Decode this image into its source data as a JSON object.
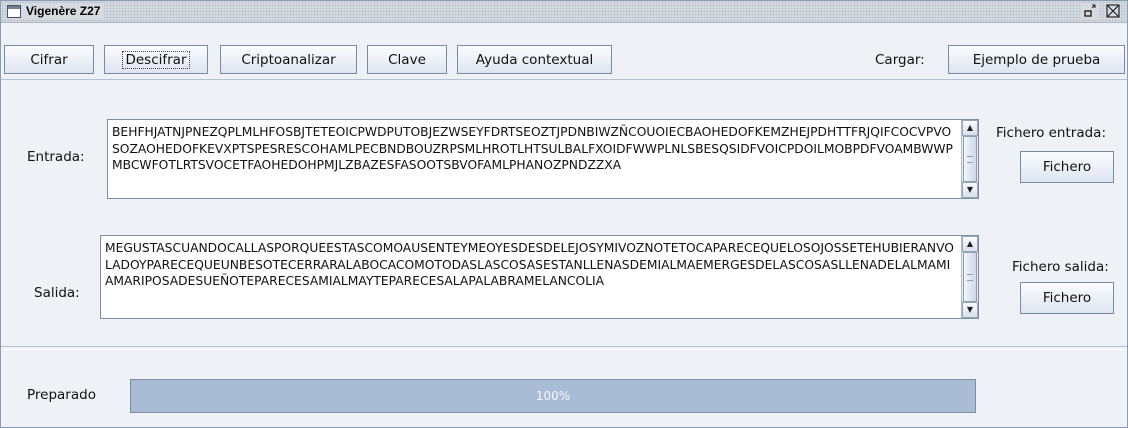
{
  "window": {
    "title": "Vigenère Z27",
    "restore_icon": "restore-icon",
    "close_icon": "close-icon"
  },
  "toolbar": {
    "cifrar": "Cifrar",
    "descifrar": "Descifrar",
    "criptoanalizar": "Criptoanalizar",
    "clave": "Clave",
    "ayuda": "Ayuda contextual",
    "cargar_label": "Cargar:",
    "ejemplo": "Ejemplo de prueba"
  },
  "entrada": {
    "label": "Entrada:",
    "text": "BEHFHJATNJPNEZQPLMLHFOSBJTETEOICPWDPUTOBJEZWSEYFDRTSEOZTJPDNBIWZÑCOUOIECBAOHEDOFKEMZHEJPDHTTFRJQIFCOCVPVOSOZAOHEDOFKEVXPTSPESRESCOHAMLPECBNDBOUZRPSMLHROTLHTSULBALFXOIDFWWPLNLSBESQSIDFVOICPDOILMOBPDFVOAMBWWPMBCWFOTLRTSVOCETFAOHEDOHPMJLZBAZESFASOOTSBVOFAMLPHANOZPNDZZXA",
    "file_label": "Fichero entrada:",
    "file_button": "Fichero"
  },
  "salida": {
    "label": "Salida:",
    "text": "MEGUSTASCUANDOCALLASPORQUEESTASCOMOAUSENTEYMEOYESDESDELEJOSYMIVOZNOTETOCAPARECEQUELOSOJOSSETEHUBIERANVOLADOYPARECEQUEUNBESOTECERRARALABOCACOMOTODASLASCOSASESTANLLENASDEMIALMAEMERGESDELASCOSASLLENADELALMAMIAMARIPOSADESUEÑOTEPARECESAMIALMAYTEPARECESALAPALABRAMELANCOLIA",
    "file_label": "Fichero salida:",
    "file_button": "Fichero"
  },
  "status": {
    "label": "Preparado",
    "progress_text": "100%",
    "progress_fraction": 1.0,
    "progress_color": "#a9bcd6"
  }
}
